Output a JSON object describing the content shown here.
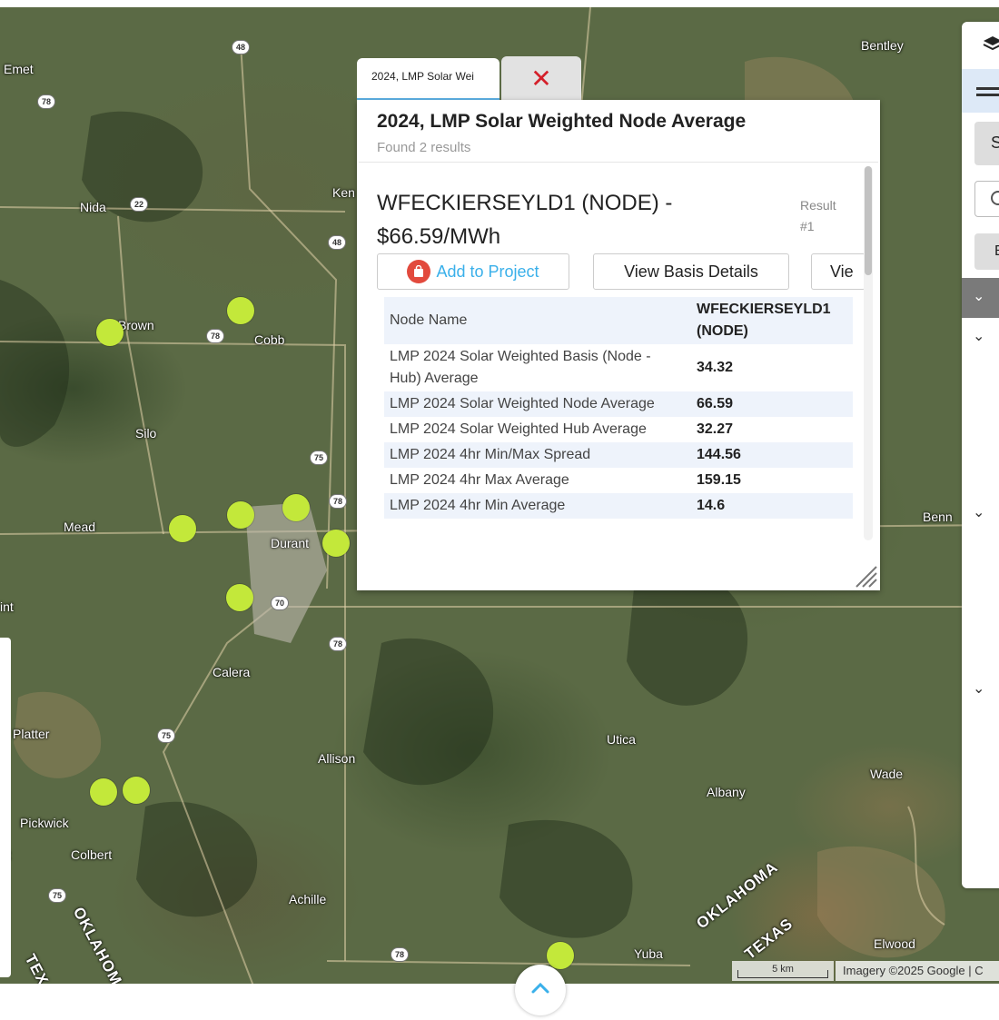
{
  "map": {
    "places": [
      {
        "name": "Emet"
      },
      {
        "name": "Bentley"
      },
      {
        "name": "Nida"
      },
      {
        "name": "Ken"
      },
      {
        "name": "Brown"
      },
      {
        "name": "Cobb"
      },
      {
        "name": "Silo"
      },
      {
        "name": "Mead"
      },
      {
        "name": "Durant"
      },
      {
        "name": "Benn"
      },
      {
        "name": "int"
      },
      {
        "name": "Calera"
      },
      {
        "name": "Platter"
      },
      {
        "name": "Utica"
      },
      {
        "name": "Allison"
      },
      {
        "name": "Wade"
      },
      {
        "name": "Albany"
      },
      {
        "name": "Pickwick"
      },
      {
        "name": "nt"
      },
      {
        "name": "Colbert"
      },
      {
        "name": "Achille"
      },
      {
        "name": "Elwood"
      },
      {
        "name": "Yuba"
      }
    ],
    "shields": [
      "48",
      "78",
      "22",
      "48",
      "78",
      "75",
      "78",
      "70",
      "78",
      "75",
      "75",
      "78"
    ],
    "state_labels": [
      "OKLAHOMA",
      "TEXAS",
      "OKLAHOMA",
      "TEX"
    ],
    "marker_color": "#c3e83a",
    "scale_label": "5 km",
    "attribution": "Imagery ©2025 Google | C"
  },
  "popup": {
    "tab_label": "2024, LMP Solar Wei",
    "title": "2024, LMP Solar Weighted Node Average",
    "subtitle": "Found 2 results",
    "result": {
      "heading_line1": "WFECKIERSEYLD1 (NODE) -",
      "heading_line2": "$66.59/MWh",
      "number_line1": "Result",
      "number_line2": "#1",
      "add_label": "Add to Project",
      "basis_label": "View Basis Details",
      "more_label": "Vie",
      "rows": [
        {
          "label": "Node Name",
          "value": "WFECKIERSEYLD1 (NODE)"
        },
        {
          "label": "LMP 2024 Solar Weighted Basis (Node - Hub) Average",
          "value": "34.32"
        },
        {
          "label": "LMP 2024 Solar Weighted Node Average",
          "value": "66.59"
        },
        {
          "label": "LMP 2024 Solar Weighted Hub Average",
          "value": "32.27"
        },
        {
          "label": "LMP 2024 4hr Min/Max Spread",
          "value": "144.56"
        },
        {
          "label": "LMP 2024 4hr Max Average",
          "value": "159.15"
        },
        {
          "label": "LMP 2024 4hr Min Average",
          "value": "14.6"
        }
      ]
    }
  },
  "right_panel": {
    "button_s": "S",
    "button_e": "E"
  },
  "colors": {
    "accent_blue": "#3ab0ea",
    "close_red": "#d4202a",
    "row_highlight": "#eef3fb"
  }
}
